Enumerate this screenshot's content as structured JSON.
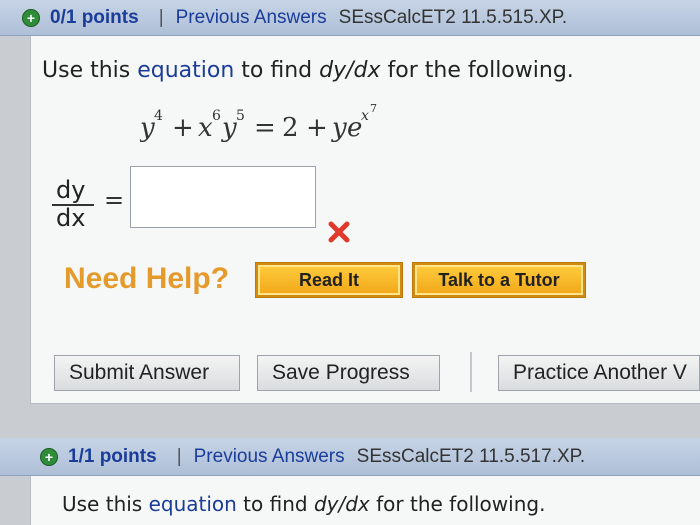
{
  "question1": {
    "points": "0/1 points",
    "separator": "|",
    "previous_answers": "Previous Answers",
    "source": "SEssCalcET2 11.5.515.XP.",
    "prompt_pre": "Use this ",
    "prompt_keyword": "equation",
    "prompt_mid": " to find ",
    "prompt_var": "dy/dx",
    "prompt_post": " for the following.",
    "equation": "y^4 + x^6 y^5 = 2 + y e^(x^7)",
    "fraction_num": "dy",
    "fraction_den": "dx",
    "equals": "=",
    "answer_value": "",
    "status": "incorrect",
    "need_help": "Need Help?",
    "read_it": "Read It",
    "talk_to_tutor": "Talk to a Tutor",
    "submit_answer": "Submit Answer",
    "save_progress": "Save Progress",
    "practice_another": "Practice Another V"
  },
  "question2": {
    "points": "1/1 points",
    "separator": "|",
    "previous_answers": "Previous Answers",
    "source": "SEssCalcET2 11.5.517.XP.",
    "prompt_pre": "Use this ",
    "prompt_keyword": "equation",
    "prompt_mid": " to find ",
    "prompt_var": "dy/dx",
    "prompt_post": " for the following."
  },
  "colors": {
    "header_bg": "#b8c7dc",
    "link": "#1a3d9a",
    "need_help": "#e59a2c",
    "help_button": "#f5b72a",
    "wrong_mark": "#e0392b",
    "plus_badge": "#2f8d3a"
  },
  "icons": {
    "expand": "plus-circle-icon",
    "wrong": "red-x-icon"
  }
}
